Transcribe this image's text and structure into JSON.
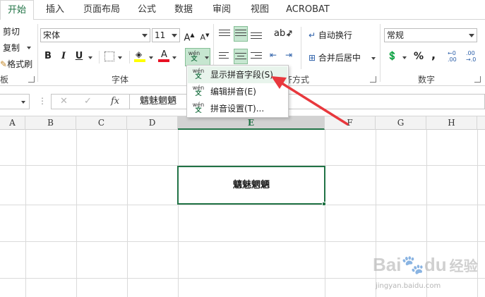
{
  "tabs": [
    "开始",
    "插入",
    "页面布局",
    "公式",
    "数据",
    "审阅",
    "视图",
    "ACROBAT"
  ],
  "clipboard": {
    "cut": "剪切",
    "copy": "复制",
    "format_painter": "格式刷",
    "group_label_fragment": "板"
  },
  "font": {
    "name": "宋体",
    "size": "11",
    "grow": "A",
    "shrink": "A",
    "bold": "B",
    "italic": "I",
    "underline": "U",
    "font_color_letter": "A",
    "group_label": "字体",
    "phonetic_top": "wén",
    "phonetic_bottom": "文"
  },
  "alignment": {
    "wrap_text": "自动换行",
    "merge_center": "合并后居中",
    "group_label_fragment": "齐方式"
  },
  "number": {
    "format": "常规",
    "percent": "%",
    "comma": ",",
    "group_label": "数字",
    "inc_decimal_top": "←0",
    "inc_decimal_bottom": ".00",
    "dec_decimal_top": ".00",
    "dec_decimal_bottom": "→.0"
  },
  "formula_bar": {
    "cancel": "✕",
    "enter": "✓",
    "fx": "fx",
    "content": "魑魅魍魉"
  },
  "columns": [
    "A",
    "B",
    "C",
    "D",
    "E",
    "F",
    "G",
    "H"
  ],
  "cell_value": "魑魅魍魉",
  "menu": {
    "items": [
      {
        "label": "显示拼音字段(S)"
      },
      {
        "label": "编辑拼音(E)"
      },
      {
        "label": "拼音设置(T)..."
      }
    ]
  },
  "watermark": {
    "brand": "Bai",
    "paw": "du",
    "sub": "经验",
    "url": "jingyan.baidu.com"
  },
  "colors": {
    "accent": "#217346",
    "arrow": "#e8383d",
    "highlight": "#c6e6d0"
  }
}
